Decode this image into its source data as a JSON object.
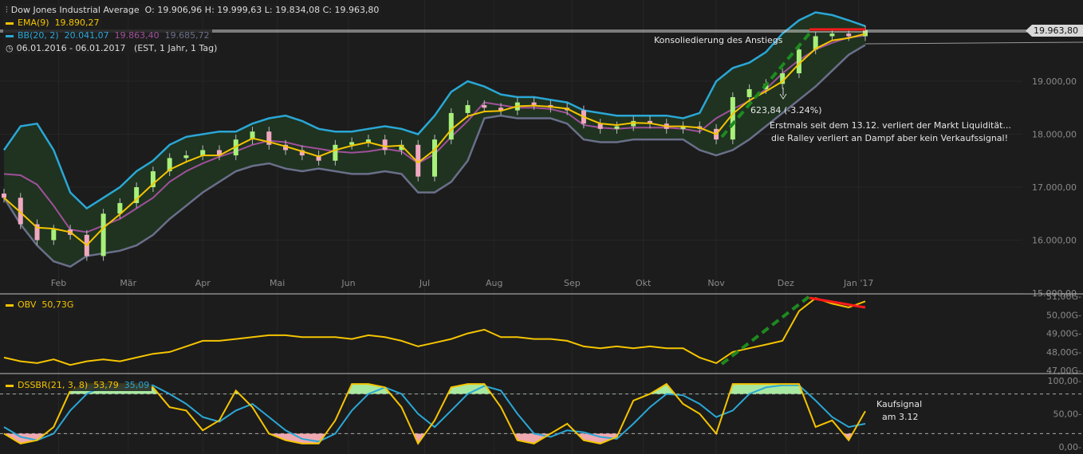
{
  "header": {
    "title": "Dow Jones Industrial Average",
    "ohlc": "O: 19.906,96  H: 19.999,63  L: 19.834,08  C: 19.963,80",
    "ema_label": "EMA(9)",
    "ema_value": "19.890,27",
    "bb_label": "BB(20, 2)",
    "bb_upper": "20.041,07",
    "bb_mid": "19.863,40",
    "bb_lower": "19.685,72",
    "range": "06.01.2016 - 06.01.2017",
    "range_info": "(EST, 1 Jahr, 1 Tag)"
  },
  "price_tag": "19.963,80",
  "obv_legend": {
    "label": "OBV",
    "value": "50,73G"
  },
  "dss_legend": {
    "label": "DSSBR(21, 3, 8)",
    "k": "53,79",
    "d": "35,09"
  },
  "annotations": {
    "consolidation": "Konsoliedierung des Anstiegs",
    "drop": "623,84 (-3.24%)",
    "note1": "Erstmals seit dem 13.12. verliert der Markt Liquidität...",
    "note2": "die Ralley verliert an Dampf aber kein Verkaufssignal!",
    "buy1": "Kaufsignal",
    "buy2": "am 3.12"
  },
  "colors": {
    "ema": "#f5c400",
    "bb_upper": "#2aa7d6",
    "bb_mid": "#a0509a",
    "bb_lower": "#6a6f8a",
    "up": "#a8f07a",
    "down": "#f0a8c0",
    "trend": "#1e8a1e",
    "resist": "#ff1a1a"
  },
  "chart_data": [
    {
      "type": "line",
      "title": "Dow Jones Industrial Average",
      "ylim": [
        15000,
        20400
      ],
      "yticks": [
        "19.000,00",
        "18.000,00",
        "17.000,00",
        "16.000,00",
        "15.000,00"
      ],
      "ytick_values": [
        19000,
        18000,
        17000,
        16000,
        15000
      ],
      "months": [
        "Feb",
        "Mär",
        "Apr",
        "Mai",
        "Jun",
        "Jul",
        "Aug",
        "Sep",
        "Okt",
        "Nov",
        "Dez",
        "Jan '17"
      ],
      "month_weeks": [
        3.3,
        7.5,
        12,
        16.5,
        20.8,
        25.4,
        29.6,
        34.3,
        38.6,
        43,
        47.2,
        51.6
      ],
      "close": [
        16800,
        16300,
        16000,
        16200,
        16100,
        15700,
        16500,
        16700,
        17000,
        17300,
        17550,
        17600,
        17700,
        17600,
        17900,
        18050,
        17800,
        17700,
        17600,
        17500,
        17800,
        17850,
        17900,
        17700,
        17800,
        17200,
        17900,
        18400,
        18550,
        18500,
        18450,
        18600,
        18550,
        18500,
        18450,
        18200,
        18100,
        18150,
        18250,
        18200,
        18100,
        18150,
        18100,
        17900,
        18700,
        18850,
        18950,
        19150,
        19600,
        19850,
        19900,
        19850,
        19963
      ],
      "bb_upper": [
        17700,
        18150,
        18200,
        17700,
        16900,
        16600,
        16800,
        17000,
        17300,
        17500,
        17800,
        17950,
        18000,
        18050,
        18050,
        18200,
        18300,
        18350,
        18250,
        18100,
        18050,
        18050,
        18100,
        18150,
        18100,
        18000,
        18350,
        18800,
        19000,
        18900,
        18750,
        18700,
        18700,
        18650,
        18600,
        18450,
        18400,
        18350,
        18350,
        18350,
        18350,
        18300,
        18400,
        19000,
        19250,
        19350,
        19550,
        19900,
        20150,
        20300,
        20250,
        20150,
        20041
      ],
      "bb_lower": [
        16800,
        16300,
        15900,
        15600,
        15500,
        15700,
        15750,
        15800,
        15900,
        16100,
        16400,
        16650,
        16900,
        17100,
        17300,
        17400,
        17450,
        17350,
        17300,
        17350,
        17300,
        17250,
        17250,
        17300,
        17250,
        16900,
        16900,
        17100,
        17500,
        18300,
        18350,
        18300,
        18300,
        18300,
        18200,
        17900,
        17850,
        17850,
        17900,
        17900,
        17900,
        17900,
        17700,
        17600,
        17700,
        17900,
        18150,
        18400,
        18650,
        18900,
        19200,
        19500,
        19685
      ]
    },
    {
      "type": "line",
      "title": "OBV",
      "ylim": [
        46.9,
        51.1
      ],
      "yticks": [
        "51,00G",
        "50,00G",
        "49,00G",
        "48,00G",
        "47,00G"
      ],
      "ytick_values": [
        51,
        50,
        49,
        48,
        47
      ],
      "values": [
        47.7,
        47.5,
        47.4,
        47.6,
        47.3,
        47.5,
        47.6,
        47.5,
        47.7,
        47.9,
        48.0,
        48.3,
        48.6,
        48.6,
        48.7,
        48.8,
        48.9,
        48.9,
        48.8,
        48.8,
        48.8,
        48.7,
        48.9,
        48.8,
        48.6,
        48.3,
        48.5,
        48.7,
        49.0,
        49.2,
        48.8,
        48.8,
        48.7,
        48.7,
        48.6,
        48.3,
        48.2,
        48.3,
        48.2,
        48.3,
        48.2,
        48.2,
        47.7,
        47.4,
        48.0,
        48.2,
        48.4,
        48.6,
        50.2,
        50.9,
        50.6,
        50.4,
        50.73
      ]
    },
    {
      "type": "line",
      "title": "DSSBR(21, 3, 8)",
      "ylim": [
        0,
        100
      ],
      "yticks": [
        "100,00",
        "50,00",
        "0,00"
      ],
      "ytick_values": [
        100,
        50,
        0
      ],
      "levels": [
        80,
        20
      ],
      "k": [
        20,
        5,
        10,
        30,
        85,
        95,
        95,
        95,
        95,
        90,
        60,
        55,
        25,
        40,
        85,
        60,
        20,
        10,
        5,
        5,
        40,
        95,
        95,
        90,
        60,
        5,
        40,
        90,
        95,
        95,
        60,
        10,
        5,
        20,
        35,
        10,
        5,
        15,
        70,
        80,
        95,
        65,
        50,
        20,
        95,
        95,
        95,
        95,
        95,
        30,
        40,
        10,
        54
      ],
      "d": [
        30,
        15,
        10,
        20,
        55,
        80,
        92,
        95,
        95,
        93,
        80,
        65,
        45,
        38,
        55,
        65,
        45,
        25,
        12,
        8,
        20,
        55,
        80,
        90,
        80,
        50,
        30,
        55,
        80,
        92,
        85,
        50,
        20,
        15,
        25,
        22,
        15,
        12,
        35,
        60,
        80,
        78,
        65,
        45,
        55,
        80,
        90,
        93,
        93,
        70,
        45,
        30,
        35
      ]
    }
  ]
}
